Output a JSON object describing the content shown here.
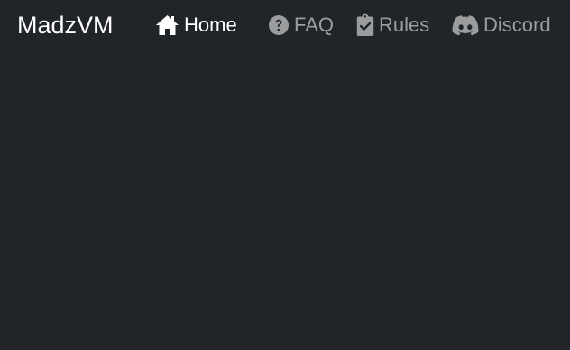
{
  "brand": {
    "name": "MadzVM"
  },
  "nav": {
    "items": [
      {
        "label": "Home",
        "icon": "home-icon",
        "active": true
      },
      {
        "label": "FAQ",
        "icon": "question-circle-icon",
        "active": false
      },
      {
        "label": "Rules",
        "icon": "clipboard-check-icon",
        "active": false
      },
      {
        "label": "Discord",
        "icon": "discord-icon",
        "active": false
      }
    ]
  },
  "colors": {
    "background": "#212529",
    "active_link": "#ffffff",
    "inactive_link": "rgba(255,255,255,0.55)"
  }
}
